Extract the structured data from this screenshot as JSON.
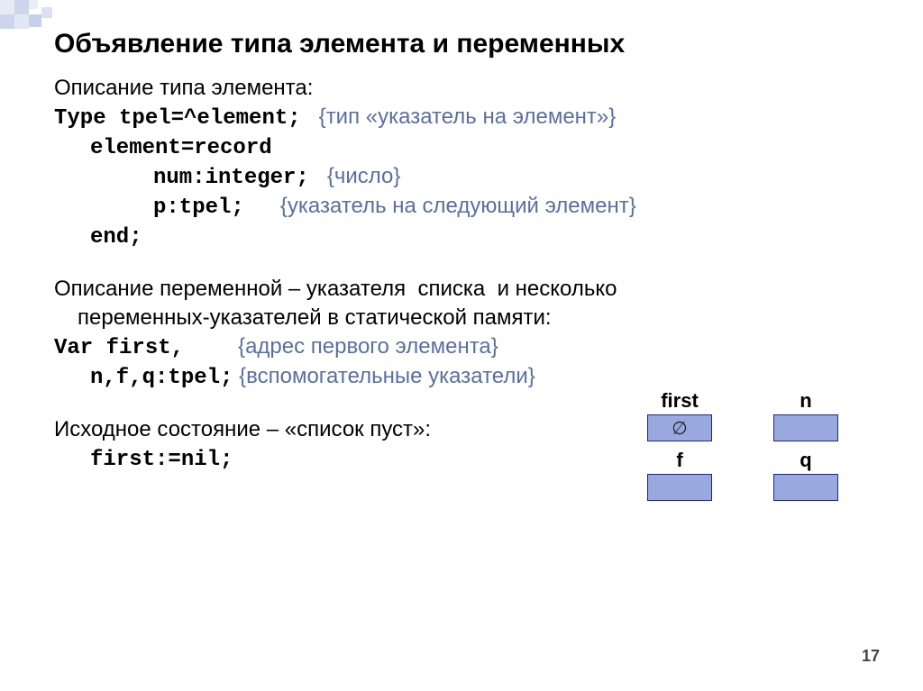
{
  "title": "Объявление типа элемента и переменных",
  "desc_type": "Описание типа элемента:",
  "code": {
    "l1": "Type tpel=^element;",
    "c1": "{тип «указатель на элемент»}",
    "l2": "element=record",
    "l3": "num:integer;",
    "c3": "{число}",
    "l4": "p:tpel;",
    "c4": "{указатель на следующий элемент}",
    "l5": "end;"
  },
  "desc_var1": "Описание переменной – указателя  списка  и несколько",
  "desc_var2": "переменных-указателей в статической памяти:",
  "var": {
    "l1": "Var first,",
    "c1": "{адрес первого элемента}",
    "l2": "n,f,q:tpel;",
    "c2": "{вспомогательные указатели}"
  },
  "desc_state": "Исходное состояние – «список пуст»:",
  "init": "first:=nil;",
  "boxes": {
    "first": "first",
    "n": "n",
    "f": "f",
    "q": "q",
    "empty": "∅"
  },
  "page": "17"
}
